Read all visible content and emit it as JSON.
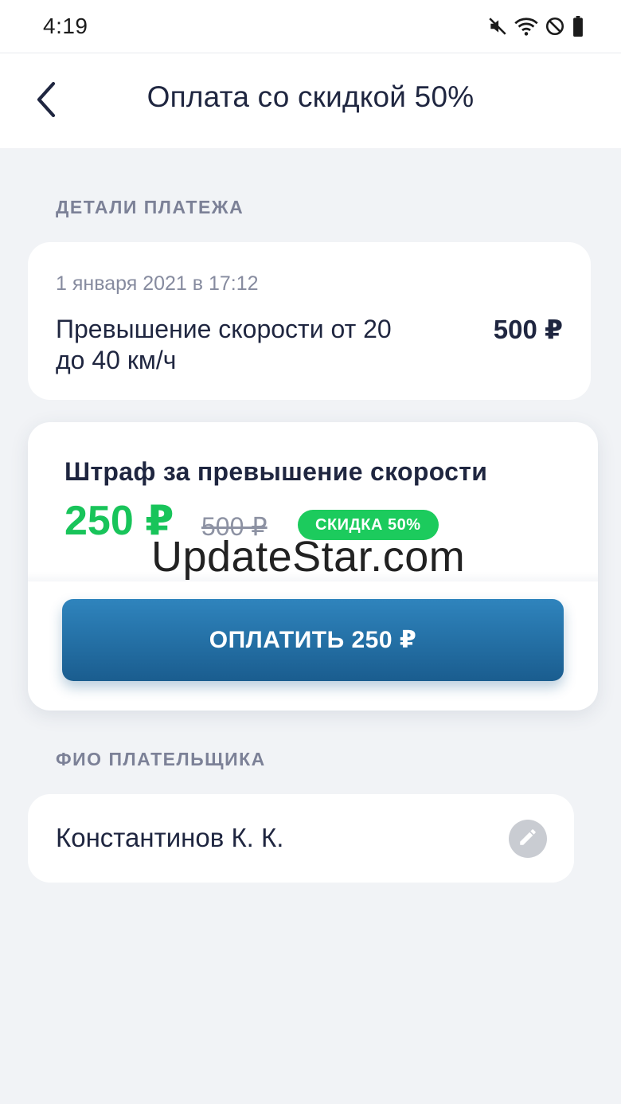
{
  "status_bar": {
    "time": "4:19",
    "icons": [
      "mute-icon",
      "wifi-icon",
      "do-not-disturb-icon",
      "battery-icon"
    ]
  },
  "app_bar": {
    "back_icon": "chevron-left-icon",
    "title": "Оплата со скидкой 50%"
  },
  "payment_details": {
    "section_label": "ДЕТАЛИ ПЛАТЕЖА",
    "date": "1 января 2021 в 17:12",
    "description": "Превышение скорости от 20 до 40 км/ч",
    "amount": "500 ₽"
  },
  "fine": {
    "title": "Штраф за превышение скорости",
    "price_new": "250 ₽",
    "price_old": "500 ₽",
    "badge": "СКИДКА 50%",
    "pay_button_label": "ОПЛАТИТЬ 250 ₽"
  },
  "watermark": "UpdateStar.com",
  "payer": {
    "section_label": "ФИО ПЛАТЕЛЬЩИКА",
    "name": "Константинов К. К.",
    "edit_icon": "pencil-icon"
  },
  "colors": {
    "accent_green": "#18c45a",
    "button_blue": "#2373a8",
    "background": "#f1f3f6",
    "text_dark": "#1f2640"
  }
}
